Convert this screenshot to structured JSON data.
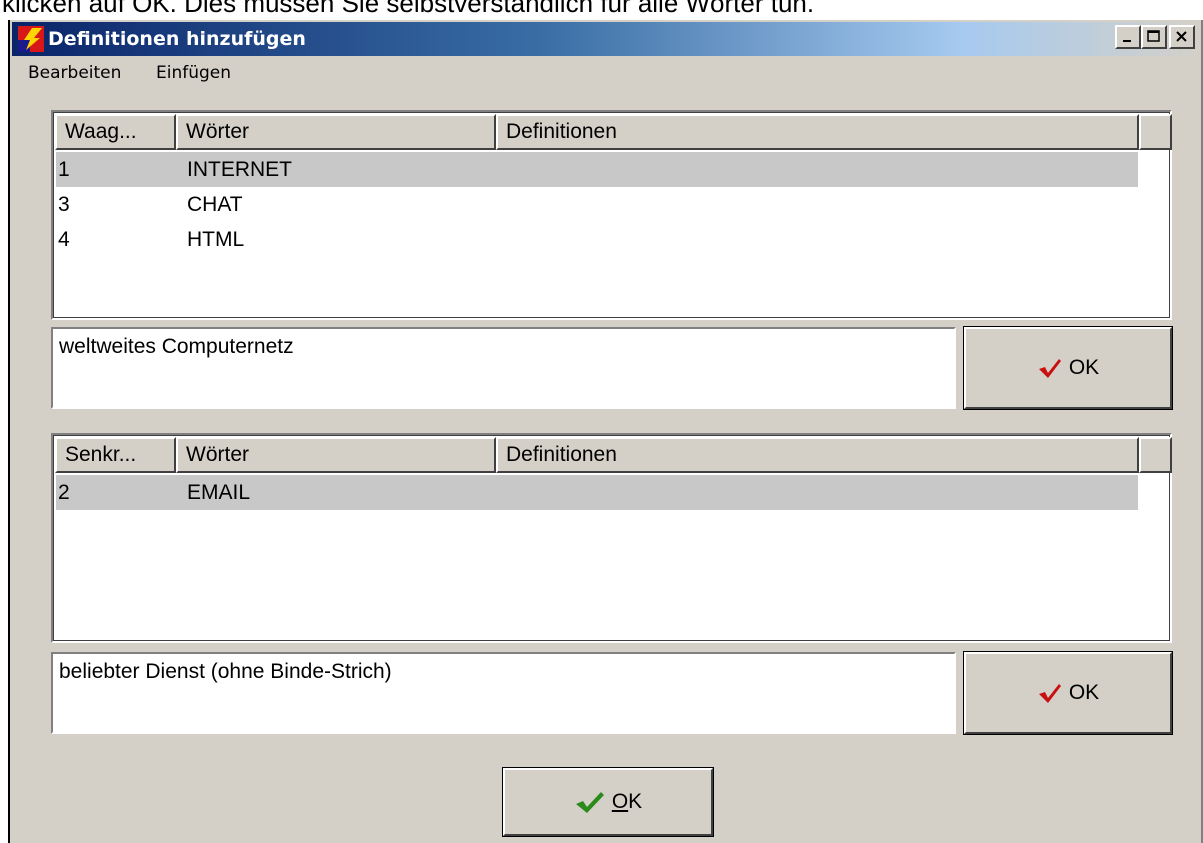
{
  "caption_fragment": "klicken auf OK. Dies müssen Sie selbstverständlich für alle Wörter tun.",
  "window": {
    "title": "Definitionen hinzufügen",
    "controls": {
      "minimize": "minimize",
      "maximize": "maximize",
      "close": "close"
    }
  },
  "menu": [
    {
      "label": "Bearbeiten"
    },
    {
      "label": "Einfügen"
    }
  ],
  "across_table": {
    "columns": [
      "Waag...",
      "Wörter",
      "Definitionen"
    ],
    "rows": [
      {
        "number": "1",
        "word": "INTERNET",
        "definition": ""
      },
      {
        "number": "3",
        "word": "CHAT",
        "definition": ""
      },
      {
        "number": "4",
        "word": "HTML",
        "definition": ""
      }
    ],
    "selected_row": 0
  },
  "across_definition": {
    "value": "weltweites Computernetz"
  },
  "across_ok": {
    "label": "OK"
  },
  "down_table": {
    "columns": [
      "Senkr...",
      "Wörter",
      "Definitionen"
    ],
    "rows": [
      {
        "number": "2",
        "word": "EMAIL",
        "definition": ""
      }
    ],
    "selected_row": 0
  },
  "down_definition": {
    "value": "beliebter Dienst (ohne Binde-Strich)"
  },
  "down_ok": {
    "label": "OK"
  },
  "main_ok": {
    "mnemonic": "O",
    "rest": "K"
  },
  "colors": {
    "checkmark_red": "#c81010",
    "checkmark_green": "#2a8a1a",
    "titlebar_start": "#0a246a",
    "selection": "#c8c8c8"
  },
  "icons": [
    "app-icon",
    "minimize-icon",
    "maximize-icon",
    "close-icon",
    "checkmark-icon"
  ]
}
